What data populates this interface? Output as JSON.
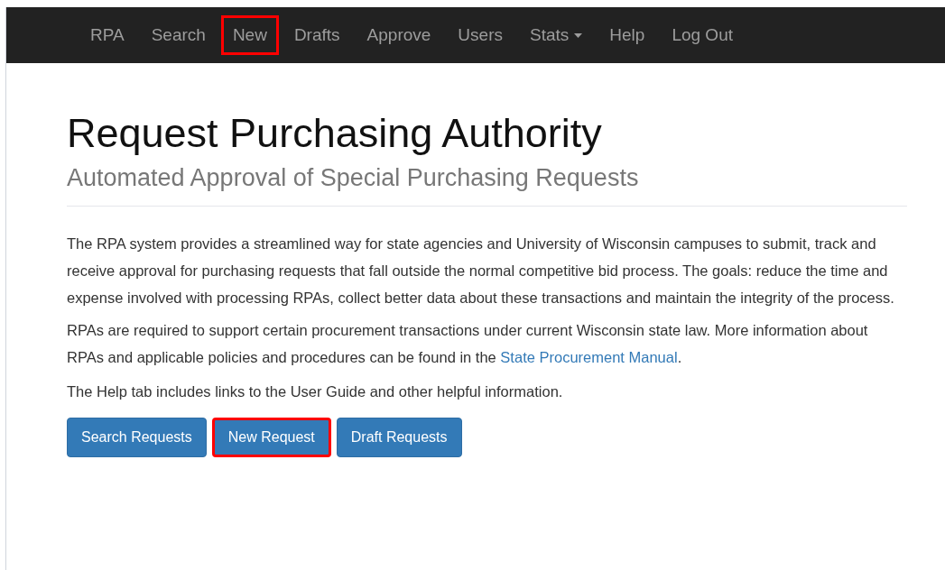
{
  "nav": [
    {
      "label": "RPA",
      "kind": "link",
      "highlighted": false
    },
    {
      "label": "Search",
      "kind": "link",
      "highlighted": false
    },
    {
      "label": "New",
      "kind": "link",
      "highlighted": true
    },
    {
      "label": "Drafts",
      "kind": "link",
      "highlighted": false
    },
    {
      "label": "Approve",
      "kind": "link",
      "highlighted": false
    },
    {
      "label": "Users",
      "kind": "link",
      "highlighted": false
    },
    {
      "label": "Stats",
      "kind": "dropdown",
      "highlighted": false
    },
    {
      "label": "Help",
      "kind": "link",
      "highlighted": false
    },
    {
      "label": "Log Out",
      "kind": "link",
      "highlighted": false
    }
  ],
  "title": "Request Purchasing Authority",
  "subtitle": "Automated Approval of Special Purchasing Requests",
  "intro": "The RPA system provides a streamlined way for state agencies and University of Wisconsin campuses to submit, track and receive approval for purchasing requests that fall outside the normal competitive bid process. The goals: reduce the time and expense involved with processing RPAs, collect better data about these transactions and maintain the integrity of the process.",
  "law": {
    "text": "RPAs are required to support certain procurement transactions under current Wisconsin state law. More information about RPAs and applicable policies and procedures can be found in the",
    "link": "State Procurement Manual",
    "after": "."
  },
  "help_note": "The Help tab includes links to the User Guide and other helpful information.",
  "buttons": [
    {
      "label": "Search Requests",
      "highlighted": false
    },
    {
      "label": "New Request",
      "highlighted": true
    },
    {
      "label": "Draft Requests",
      "highlighted": false
    }
  ]
}
